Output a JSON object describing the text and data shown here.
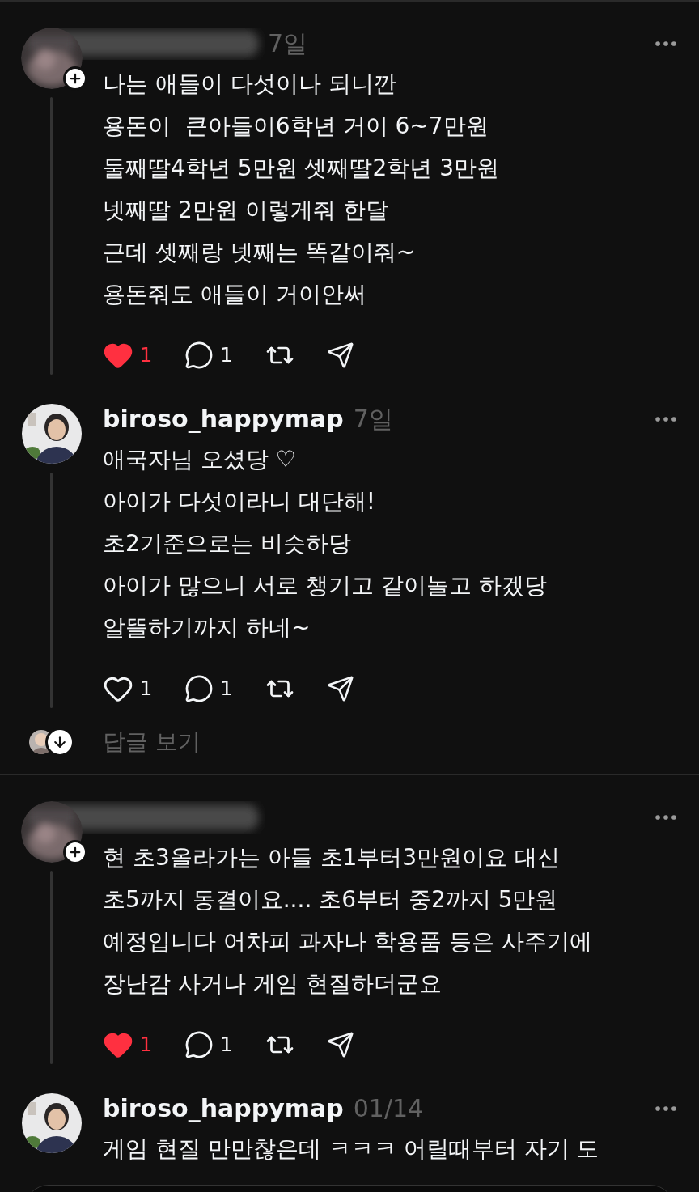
{
  "posts": [
    {
      "author": {
        "redacted": true
      },
      "time": "7일",
      "follow_badge": true,
      "lines": [
        "나는 애들이 다섯이나 되니깐",
        "용돈이  큰아들이6학년 거이 6~7만원",
        "둘째딸4학년 5만원 셋째딸2학년 3만원",
        "넷째딸 2만원 이렇게줘 한달",
        "근데 셋째랑 넷째는 똑같이줘~",
        "용돈줘도 애들이 거이안써"
      ],
      "liked": true,
      "likes": "1",
      "replies": "1"
    },
    {
      "author": {
        "redacted": false,
        "name": "biroso_happymap"
      },
      "time": "7일",
      "follow_badge": false,
      "lines": [
        "애국자님 오셨당 ♡",
        "아이가 다섯이라니 대단해!",
        "초2기준으로는 비슷하당",
        "아이가 많으니 서로 챙기고 같이놀고 하겠당",
        "알뜰하기까지 하네~"
      ],
      "liked": false,
      "likes": "1",
      "replies": "1",
      "view_replies": "답글 보기"
    },
    {
      "author": {
        "redacted": true
      },
      "follow_badge": true,
      "lines": [
        "현 초3올라가는 아들 초1부터3만원이요 대신",
        "초5까지 동결이요.... 초6부터 중2까지 5만원",
        "예정입니다 어차피 과자나 학용품 등은 사주기에",
        "장난감 사거나 게임 현질하더군요"
      ],
      "liked": true,
      "likes": "1",
      "replies": "1"
    },
    {
      "author": {
        "redacted": false,
        "name": "biroso_happymap"
      },
      "time": "01/14",
      "follow_badge": false,
      "lines": [
        "게임 현질 만만찮은데 ㅋㅋㅋ 어릴때부터 자기 도"
      ]
    }
  ]
}
